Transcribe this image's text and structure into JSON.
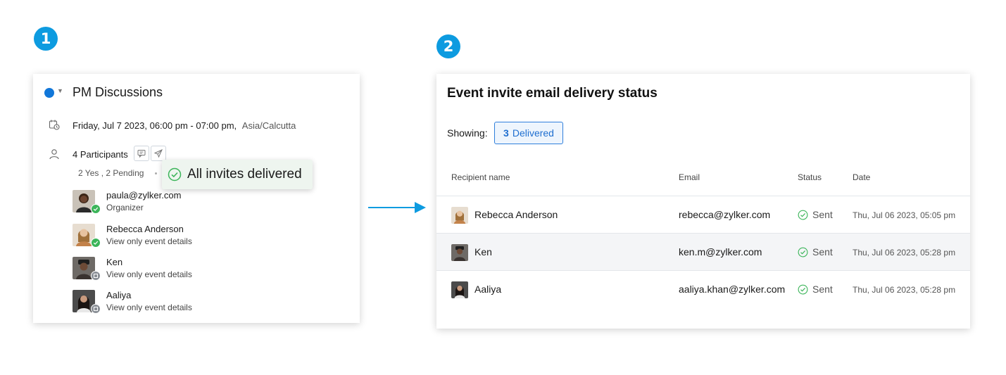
{
  "steps": [
    "1",
    "2"
  ],
  "event": {
    "title": "PM Discussions",
    "datetime": "Friday, Jul 7 2023,  06:00 pm  - 07:00 pm,",
    "timezone": "Asia/Calcutta",
    "participants_label": "4 Participants",
    "rsvp_summary": "2 Yes , 2 Pending",
    "toast": "All invites delivered",
    "participants": [
      {
        "name": "paula@zylker.com",
        "role": "Organizer",
        "status": "accepted"
      },
      {
        "name": "Rebecca Anderson",
        "role": "View only event details",
        "status": "accepted"
      },
      {
        "name": "Ken",
        "role": "View only event details",
        "status": "pending"
      },
      {
        "name": "Aaliya",
        "role": "View only event details",
        "status": "pending"
      }
    ]
  },
  "delivery": {
    "title": "Event invite email delivery status",
    "showing_label": "Showing:",
    "filter_count": "3",
    "filter_label": "Delivered",
    "columns": [
      "Recipient name",
      "Email",
      "Status",
      "Date"
    ],
    "rows": [
      {
        "name": "Rebecca Anderson",
        "email": "rebecca@zylker.com",
        "status": "Sent",
        "date": "Thu, Jul 06 2023, 05:05 pm"
      },
      {
        "name": "Ken",
        "email": "ken.m@zylker.com",
        "status": "Sent",
        "date": "Thu, Jul 06 2023, 05:28 pm"
      },
      {
        "name": "Aaliya",
        "email": "aaliya.khan@zylker.com",
        "status": "Sent",
        "date": "Thu, Jul 06 2023, 05:28 pm"
      }
    ]
  },
  "colors": {
    "accent": "#0d9be0",
    "calendar": "#1177d9",
    "success": "#3cb55a",
    "filter": "#2f7fdc"
  },
  "icons": [
    "calendar-dot-icon",
    "chevron-down-icon",
    "calendar-clock-icon",
    "person-icon",
    "chat-icon",
    "send-icon",
    "check-circle-icon",
    "arrow-right-icon"
  ]
}
